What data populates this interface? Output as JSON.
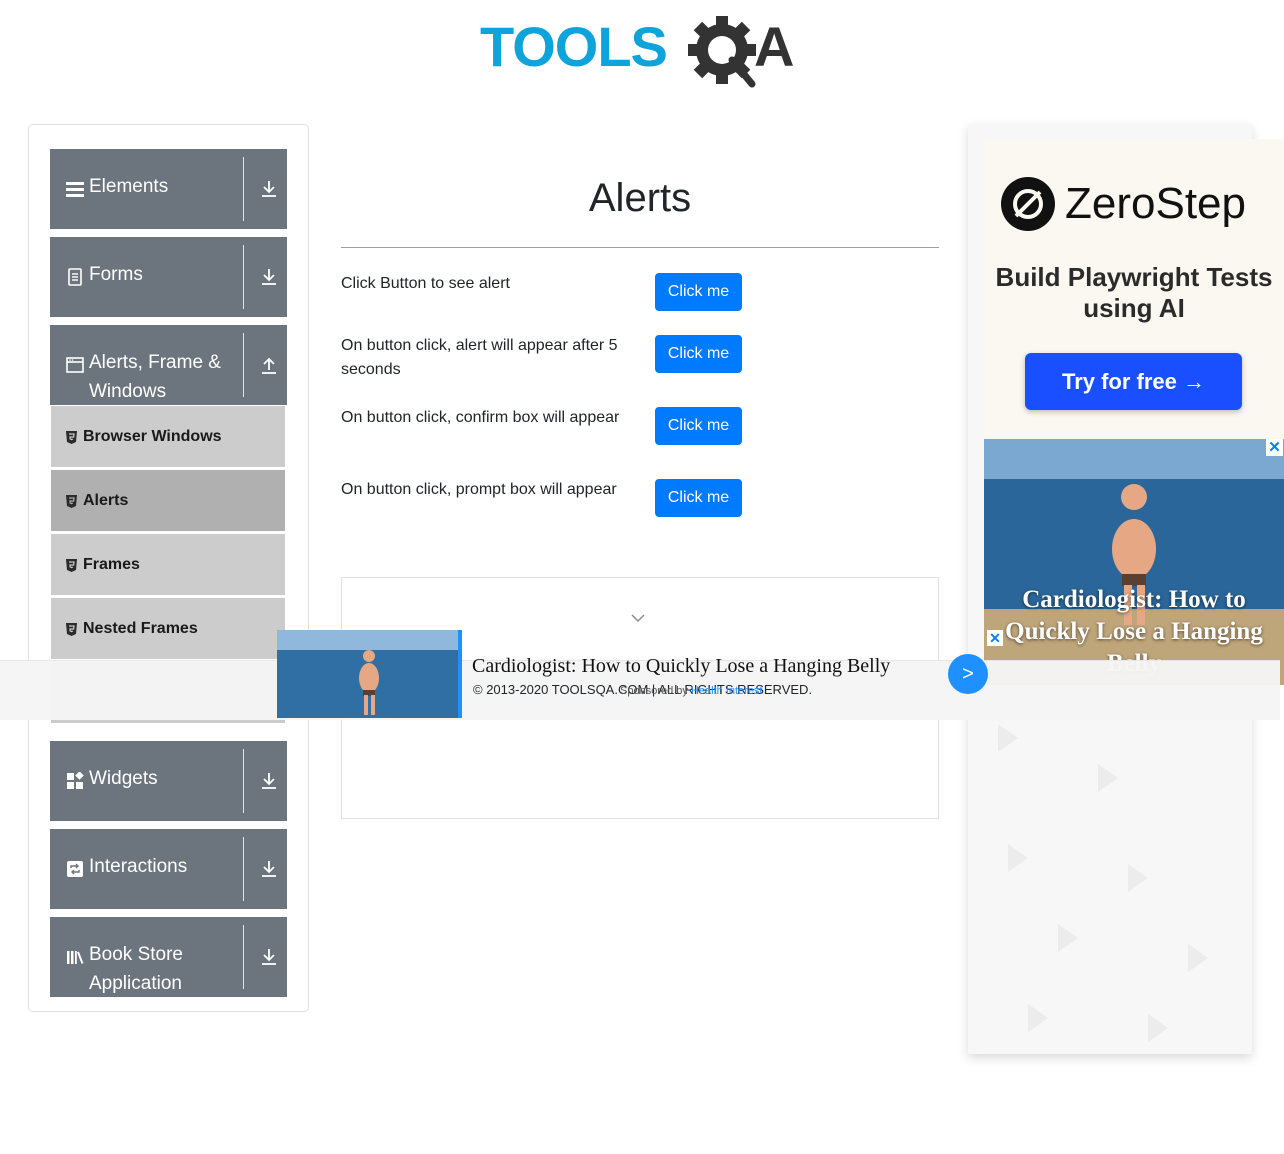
{
  "logo": {
    "text_left": "TOOLS",
    "text_right": "A",
    "colors": {
      "blue": "#0fa3dc",
      "dark": "#333333"
    }
  },
  "sidebar": {
    "groups": [
      {
        "label": "Elements",
        "icon": "list-icon",
        "arrow": "download-icon"
      },
      {
        "label": "Forms",
        "icon": "document-icon",
        "arrow": "download-icon"
      },
      {
        "label": "Alerts, Frame & Windows",
        "icon": "browser-window-icon",
        "arrow": "upload-icon"
      },
      {
        "label": "Widgets",
        "icon": "widgets-icon",
        "arrow": "download-icon"
      },
      {
        "label": "Interactions",
        "icon": "repeat-icon",
        "arrow": "download-icon"
      },
      {
        "label": "Book Store Application",
        "icon": "library-icon",
        "arrow": "download-icon"
      }
    ],
    "sub_items": [
      {
        "label": "Browser Windows",
        "active": false
      },
      {
        "label": "Alerts",
        "active": true
      },
      {
        "label": "Frames",
        "active": false
      },
      {
        "label": "Nested Frames",
        "active": false
      }
    ]
  },
  "main": {
    "title": "Alerts",
    "rows": [
      {
        "text": "Click Button to see alert",
        "button": "Click me"
      },
      {
        "text": "On button click, alert will appear after 5 seconds",
        "button": "Click me"
      },
      {
        "text": "On button click, confirm box will appear",
        "button": "Click me"
      },
      {
        "text": "On button click, prompt box will appear",
        "button": "Click me"
      }
    ]
  },
  "right_ad": {
    "brand": "ZeroStep",
    "tagline": "Build Playwright Tests using AI",
    "cta": "Try for free →",
    "photo_caption": "Cardiologist: How to Quickly Lose a Hanging Belly",
    "close": "✕"
  },
  "bottom_bar": {
    "headline": "Cardiologist: How to Quickly Lose a Hanging Belly",
    "footer": "© 2013-2020 TOOLSQA.COM | ALL RIGHTS RESERVED.",
    "sponsored_prefix": "Sponsored by",
    "sponsored_link": "Health Interest",
    "next": ">",
    "close": "✕"
  },
  "colors": {
    "primary": "#007bff",
    "sidebar_group": "#6c757d",
    "sub_item": "#cccccc",
    "sub_active": "#b0b0b0"
  }
}
